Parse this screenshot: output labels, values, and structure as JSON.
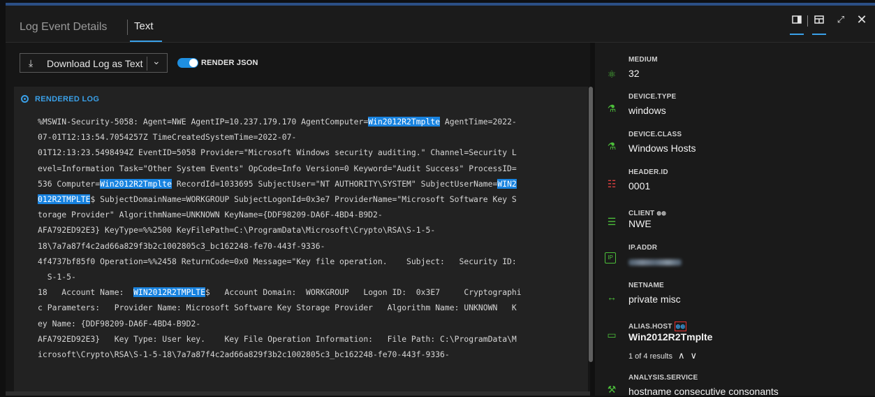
{
  "header": {
    "tab_details": "Log Event Details",
    "tab_text": "Text",
    "icons": [
      "panel-icon",
      "split-view-icon",
      "expand-icon",
      "close-icon"
    ]
  },
  "toolbar": {
    "download_label": "Download Log as Text",
    "render_json_label": "RENDER JSON",
    "render_json_on": true
  },
  "log": {
    "section_label": "RENDERED LOG",
    "lines": [
      {
        "pre": "%MSWIN-Security-5058: Agent=NWE AgentIP=10.237.179.170 AgentComputer=",
        "hl": "Win2012R2Tmplte",
        "post": " AgentTime=2022-"
      },
      {
        "pre": "07-01T12:13:54.7054257Z TimeCreatedSystemTime=2022-07-",
        "hl": "",
        "post": ""
      },
      {
        "pre": "01T12:13:23.5498494Z EventID=5058 Provider=\"Microsoft Windows security auditing.\" Channel=Security L",
        "hl": "",
        "post": ""
      },
      {
        "pre": "evel=Information Task=\"Other System Events\" OpCode=Info Version=0 Keyword=\"Audit Success\" ProcessID=",
        "hl": "",
        "post": ""
      },
      {
        "pre": "536 Computer=",
        "hl": "Win2012R2Tmplte",
        "post": " RecordId=1033695 SubjectUser=\"NT AUTHORITY\\SYSTEM\" SubjectUserName=",
        "hl2": "WIN2"
      },
      {
        "pre": "",
        "hl": "012R2TMPLTE",
        "post": "$ SubjectDomainName=WORKGROUP SubjectLogonId=0x3e7 ProviderName=\"Microsoft Software Key S"
      },
      {
        "pre": "torage Provider\" AlgorithmName=UNKNOWN KeyName={DDF98209-DA6F-4BD4-B9D2-",
        "hl": "",
        "post": ""
      },
      {
        "pre": "AFA792ED92E3} KeyType=%%2500 KeyFilePath=C:\\ProgramData\\Microsoft\\Crypto\\RSA\\S-1-5-",
        "hl": "",
        "post": ""
      },
      {
        "pre": "18\\7a7a87f4c2ad66a829f3b2c1002805c3_bc162248-fe70-443f-9336-",
        "hl": "",
        "post": ""
      },
      {
        "pre": "4f4737bf85f0 Operation=%%2458 ReturnCode=0x0 Message=\"Key file operation.    Subject:   Security ID:",
        "hl": "",
        "post": ""
      },
      {
        "pre": "  S-1-5-",
        "hl": "",
        "post": ""
      },
      {
        "pre": "18   Account Name:  ",
        "hl": "WIN2012R2TMPLTE",
        "post": "$   Account Domain:  WORKGROUP   Logon ID:  0x3E7     Cryptographi"
      },
      {
        "pre": "c Parameters:   Provider Name: Microsoft Software Key Storage Provider   Algorithm Name: UNKNOWN   K",
        "hl": "",
        "post": ""
      },
      {
        "pre": "ey Name: {DDF98209-DA6F-4BD4-B9D2-",
        "hl": "",
        "post": ""
      },
      {
        "pre": "AFA792ED92E3}   Key Type: User key.    Key File Operation Information:   File Path: C:\\ProgramData\\M",
        "hl": "",
        "post": ""
      },
      {
        "pre": "icrosoft\\Crypto\\RSA\\S-1-5-18\\7a7a87f4c2ad66a829f3b2c1002805c3_bc162248-fe70-443f-9336-",
        "hl": "",
        "post": ""
      }
    ]
  },
  "fields": [
    {
      "name": "MEDIUM",
      "value": "32",
      "icon": "medium-icon"
    },
    {
      "name": "DEVICE.TYPE",
      "value": "windows",
      "icon": "device-type-icon"
    },
    {
      "name": "DEVICE.CLASS",
      "value": "Windows Hosts",
      "icon": "device-class-icon"
    },
    {
      "name": "HEADER.ID",
      "value": "0001",
      "icon": "header-id-icon",
      "icon_color": "#e04040"
    },
    {
      "name": "CLIENT",
      "value": "NWE",
      "icon": "client-icon",
      "binocular": true
    },
    {
      "name": "IP.ADDR",
      "value": "",
      "icon": "ip-addr-icon",
      "blurred": true
    },
    {
      "name": "NETNAME",
      "value": "private misc",
      "icon": "netname-icon"
    },
    {
      "name": "ALIAS.HOST",
      "value": "Win2012R2Tmplte",
      "icon": "alias-host-icon",
      "binocular": true,
      "highlighted": true,
      "results": "1 of 4 results"
    },
    {
      "name": "ANALYSIS.SERVICE",
      "value": "hostname consecutive consonants",
      "icon": "analysis-service-icon"
    }
  ],
  "colors": {
    "accent": "#1883e0",
    "field_icon": "#4cbf3a",
    "alert": "#e04040"
  }
}
